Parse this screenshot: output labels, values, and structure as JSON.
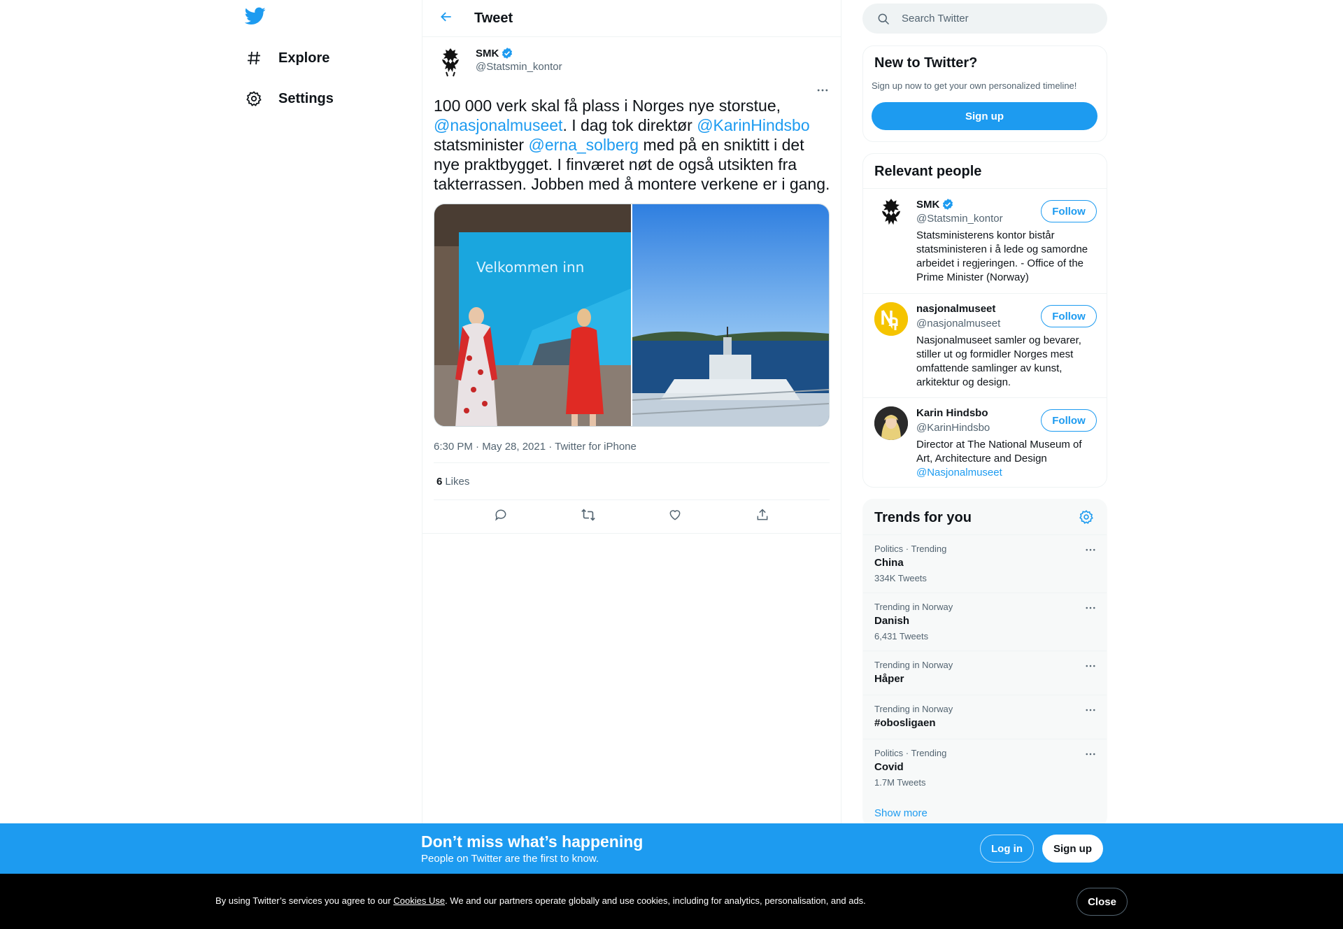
{
  "app": {
    "brand_color": "#1d9bf0"
  },
  "nav": {
    "logo_icon": "twitter-bird-icon",
    "items": [
      {
        "label": "Explore",
        "icon": "hashtag-icon"
      },
      {
        "label": "Settings",
        "icon": "gear-icon"
      }
    ]
  },
  "header": {
    "title": "Tweet",
    "back_icon": "arrow-left-icon"
  },
  "tweet": {
    "author": {
      "name": "SMK",
      "handle": "@Statsmin_kontor",
      "verified": true
    },
    "text_parts": [
      {
        "text": "100 000 verk skal få plass i Norges nye storstue, ",
        "type": "text"
      },
      {
        "text": "@nasjonalmuseet",
        "type": "mention"
      },
      {
        "text": ". I dag tok direktør ",
        "type": "text"
      },
      {
        "text": "@KarinHindsbo",
        "type": "mention"
      },
      {
        "text": " statsminister ",
        "type": "text"
      },
      {
        "text": "@erna_solberg",
        "type": "mention"
      },
      {
        "text": " med på en sniktitt i det nye praktbygget. I finværet nøt de også utsikten fra takterrassen. Jobben med å montere verkene er i gang.",
        "type": "text"
      }
    ],
    "media": [
      {
        "overlay_text": "Velkommen inn"
      },
      {}
    ],
    "meta": "6:30 PM · May 28, 2021 · Twitter for iPhone",
    "likes_count": "6",
    "likes_label": "Likes"
  },
  "search": {
    "placeholder": "Search Twitter"
  },
  "new_to_twitter": {
    "title": "New to Twitter?",
    "subtitle": "Sign up now to get your own personalized timeline!",
    "button": "Sign up"
  },
  "relevant_people": {
    "title": "Relevant people",
    "people": [
      {
        "name": "SMK",
        "handle": "@Statsmin_kontor",
        "verified": true,
        "bio": "Statsministerens kontor bistår statsministeren i å lede og samordne arbeidet i regjeringen. - Office of the Prime Minister (Norway)",
        "follow": "Follow"
      },
      {
        "name": "nasjonalmuseet",
        "handle": "@nasjonalmuseet",
        "verified": false,
        "bio": "Nasjonalmuseet samler og bevarer, stiller ut og formidler Norges mest omfattende samlinger av kunst, arkitektur og design.",
        "follow": "Follow"
      },
      {
        "name": "Karin Hindsbo",
        "handle": "@KarinHindsbo",
        "verified": false,
        "bio": "Director at The National Museum of Art, Architecture and Design",
        "bio_mention": "@Nasjonalmuseet",
        "follow": "Follow"
      }
    ]
  },
  "trends": {
    "title": "Trends for you",
    "items": [
      {
        "meta": "Politics · Trending",
        "name": "China",
        "count": "334K Tweets"
      },
      {
        "meta": "Trending in Norway",
        "name": "Danish",
        "count": "6,431 Tweets"
      },
      {
        "meta": "Trending in Norway",
        "name": "Håper",
        "count": ""
      },
      {
        "meta": "Trending in Norway",
        "name": "#obosligaen",
        "count": ""
      },
      {
        "meta": "Politics · Trending",
        "name": "Covid",
        "count": "1.7M Tweets"
      }
    ],
    "show_more": "Show more"
  },
  "bottom_bar": {
    "title": "Don’t miss what’s happening",
    "subtitle": "People on Twitter are the first to know.",
    "login": "Log in",
    "signup": "Sign up"
  },
  "cookie_bar": {
    "text_before": "By using Twitter’s services you agree to our ",
    "link": "Cookies Use",
    "text_after": ". We and our partners operate globally and use cookies, including for analytics, personalisation, and ads.",
    "close": "Close"
  }
}
